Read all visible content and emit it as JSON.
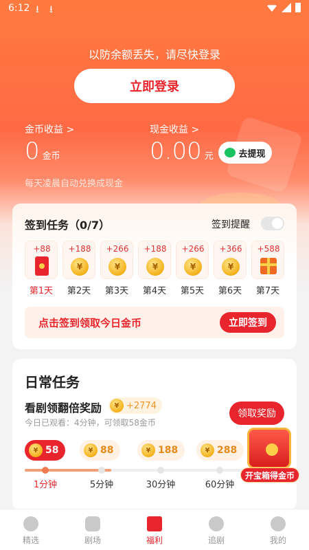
{
  "status_bar": {
    "time": "6:12",
    "download_icons": [
      "download-icon",
      "download-icon"
    ]
  },
  "header": {
    "login_hint": "以防余额丢失，请尽快登录",
    "login_button": "立即登录"
  },
  "earnings": {
    "coin_label": "金币收益 >",
    "coin_value": "0",
    "coin_unit": "金币",
    "cash_label": "现金收益 >",
    "cash_value": "0.00",
    "cash_unit": "元",
    "withdraw_button": "去提现",
    "exchange_note": "每天凌晨自动兑换成现金"
  },
  "signin": {
    "title": "签到任务（0/7）",
    "reminder_label": "签到提醒",
    "reminder_on": false,
    "days": [
      {
        "amount": "+88",
        "label": "第1天",
        "icon": "red-packet-icon"
      },
      {
        "amount": "+188",
        "label": "第2天",
        "icon": "coin-icon"
      },
      {
        "amount": "+266",
        "label": "第3天",
        "icon": "coin-icon"
      },
      {
        "amount": "+188",
        "label": "第4天",
        "icon": "coin-icon"
      },
      {
        "amount": "+266",
        "label": "第5天",
        "icon": "coin-icon"
      },
      {
        "amount": "+366",
        "label": "第6天",
        "icon": "coin-icon"
      },
      {
        "amount": "+588",
        "label": "第7天",
        "icon": "gift-icon"
      }
    ],
    "bar_text": "点击签到领取今日金币",
    "signin_button": "立即签到"
  },
  "daily": {
    "title": "日常任务",
    "task_title": "看剧领翻倍奖励",
    "task_bonus": "+2774",
    "task_sub": "今日已观看：4分钟，可领取58金币",
    "claim_button": "领取奖励",
    "rewards": [
      "58",
      "88",
      "188",
      "288"
    ],
    "ticks": [
      "1分钟",
      "5分钟",
      "30分钟",
      "60分钟"
    ],
    "progress": 0.35
  },
  "treasure": {
    "label": "开宝箱得金币"
  },
  "tabs": [
    {
      "label": "精选",
      "icon": "play-icon"
    },
    {
      "label": "剧场",
      "icon": "tv-icon"
    },
    {
      "label": "福利",
      "icon": "red-packet-icon"
    },
    {
      "label": "追剧",
      "icon": "star-icon"
    },
    {
      "label": "我的",
      "icon": "profile-icon"
    }
  ],
  "colors": {
    "accent": "#e8252c",
    "hero_top": "#ff7a3f",
    "coin": "#f3b11a"
  }
}
